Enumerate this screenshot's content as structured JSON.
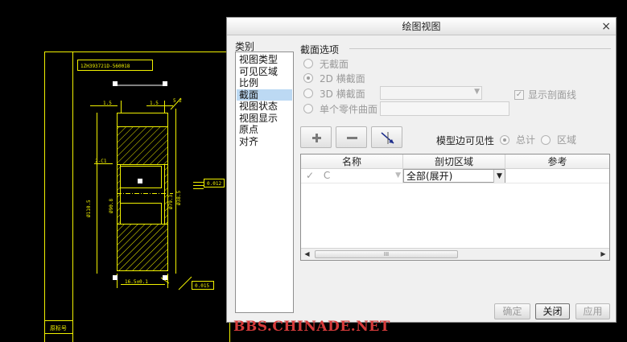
{
  "cad_drawing": {
    "title_block_text": "1ZH393721D-560018",
    "row_label": "原标号",
    "dimensions": {
      "top_left": "1.5",
      "top_right": "1.5",
      "right_top": "5.2",
      "left_chamfer": "2-C1",
      "left_diameter": "Ø110.5",
      "inner_left": "Ø90.8",
      "inner_right": "Ø79.3",
      "inner_far": "Ø38.5",
      "bottom": "16.5±0.1"
    },
    "tolerance_boxes": [
      "0.012",
      "0.015"
    ]
  },
  "dialog": {
    "title": "绘图视图",
    "close_icon": "×",
    "categories_label": "类别",
    "categories": [
      "视图类型",
      "可见区域",
      "比例",
      "截面",
      "视图状态",
      "视图显示",
      "原点",
      "对齐"
    ],
    "selected_category": "截面",
    "section_options": {
      "title": "截面选项",
      "no_section": "无截面",
      "section_2d": "2D 横截面",
      "section_3d": "3D 横截面",
      "single_part_surface": "单个零件曲面",
      "show_hatch": "显示剖面线",
      "selected": "2D 横截面"
    },
    "model_edge_visibility": {
      "label": "模型边可见性",
      "total": "总计",
      "area": "区域",
      "selected": "总计"
    },
    "table": {
      "headers": [
        "名称",
        "剖切区域",
        "参考"
      ],
      "rows": [
        {
          "check": "✓",
          "name": "C",
          "area": "全部(展开)",
          "reference": ""
        }
      ]
    },
    "scroll_grip": "III",
    "buttons": {
      "ok": "确定",
      "close": "关闭",
      "apply": "应用"
    }
  },
  "watermark": "BBS.CHINADE.NET",
  "colors": {
    "cad_line": "#f2f200",
    "cad_white": "#ffffff",
    "dialog_bg": "#f0f0f0",
    "selected_item": "#bcd9f3",
    "watermark": "#d43a3a"
  }
}
